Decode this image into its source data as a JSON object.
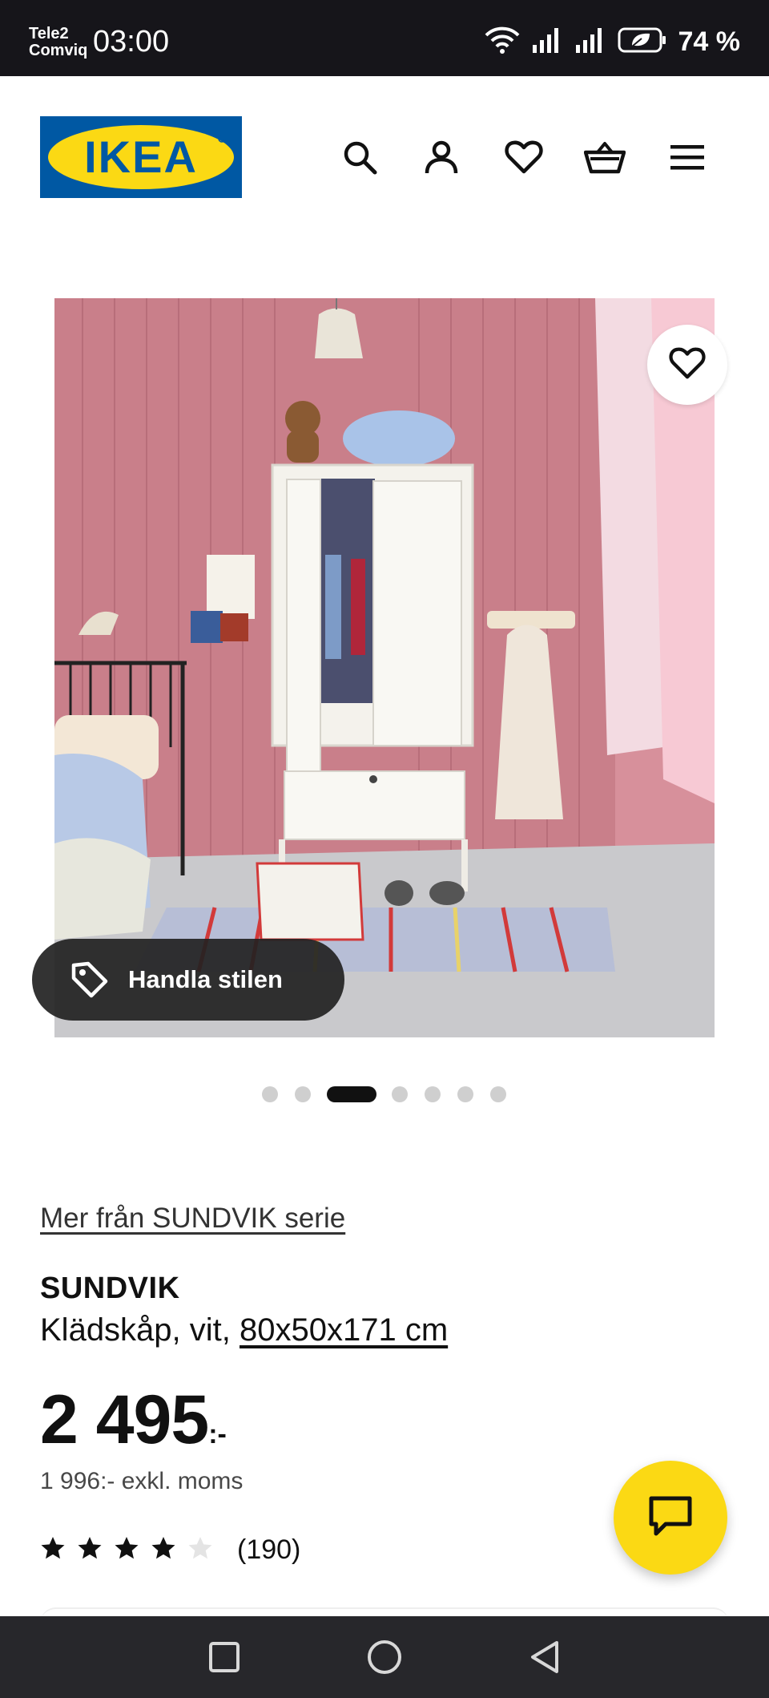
{
  "status_bar": {
    "carrier_line1": "Tele2",
    "carrier_line2": "Comviq",
    "time": "03:00",
    "battery": "74 %",
    "icons": [
      "wifi-icon",
      "signal-icon",
      "signal-icon",
      "battery-icon"
    ]
  },
  "header": {
    "logo_text": "IKEA",
    "icons": [
      "search-icon",
      "account-icon",
      "wishlist-heart-icon",
      "shopping-basket-icon",
      "menu-icon"
    ]
  },
  "gallery": {
    "current_index": 3,
    "total": 7,
    "favorite_icon": "heart-outline-icon",
    "shop_style_label": "Handla stilen",
    "shop_style_icon": "price-tag-icon"
  },
  "product": {
    "series_link": "Mer från SUNDVIK serie",
    "name": "SUNDVIK",
    "description": "Klädskåp, vit,",
    "size": "80x50x171 cm",
    "price_main": "2 495",
    "price_suffix": ":-",
    "price_excl": "1 996:- exkl. moms",
    "rating": 4,
    "rating_max": 5,
    "review_count": "(190)"
  },
  "colors": {
    "ikea_blue": "#0058a3",
    "ikea_yellow": "#fbd914",
    "status_bar": "#16151a",
    "nav_bar": "#27272b"
  },
  "chat": {
    "icon": "chat-bubble-icon"
  },
  "nav_bar": {
    "icons": [
      "recents-square-icon",
      "home-circle-icon",
      "back-triangle-icon"
    ]
  }
}
